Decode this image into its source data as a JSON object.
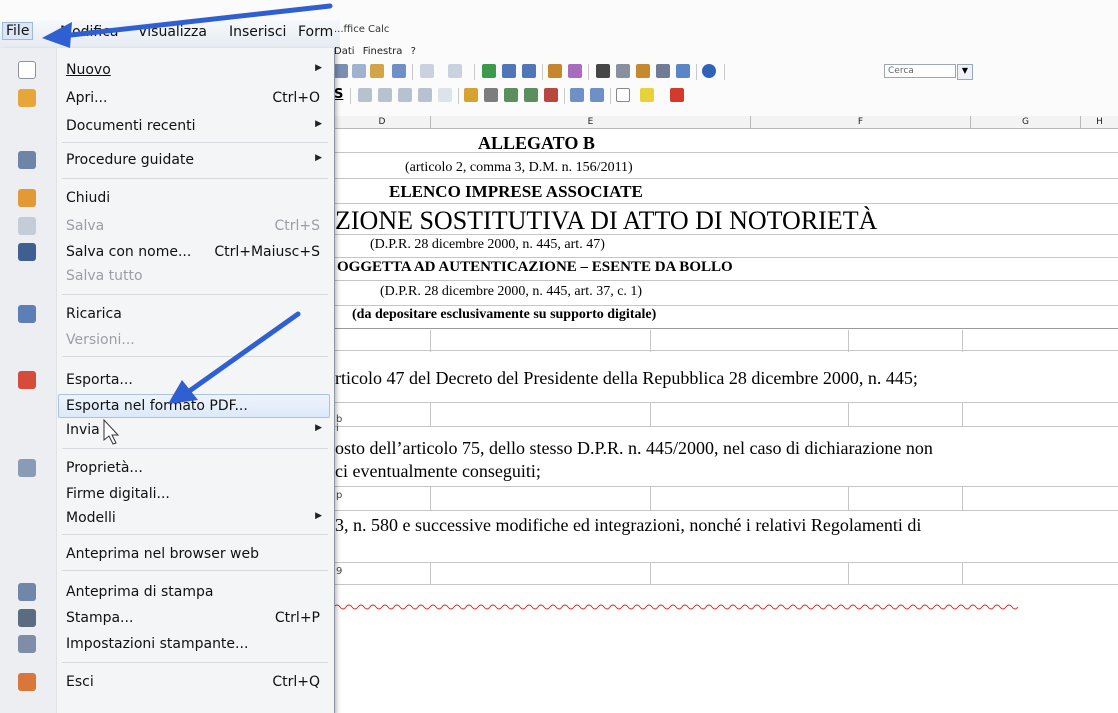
{
  "window": {
    "title": "...ffice Calc"
  },
  "menubar": {
    "items": [
      "File",
      "Modifica",
      "Visualizza",
      "Inserisci",
      "Form"
    ],
    "second_row": [
      "Dati",
      "Finestra",
      "?"
    ]
  },
  "toolbar": {
    "search_placeholder": "Cerca"
  },
  "columns": [
    "D",
    "E",
    "F",
    "G",
    "H"
  ],
  "row_fragments": [
    "b",
    "i",
    "p",
    "9"
  ],
  "sheet": {
    "allegato": "ALLEGATO B",
    "articolo": "(articolo 2, comma 3, D.M. n. 156/2011)",
    "elenco": "ELENCO IMPRESE ASSOCIATE",
    "dichiarazione": "ZIONE SOSTITUTIVA DI ATTO DI NOTORIETÀ",
    "dpr1": "(D.P.R. 28 dicembre 2000, n. 445, art. 47)",
    "soggetta": "OGGETTA AD AUTENTICAZIONE – ESENTE DA BOLLO",
    "dpr2": "(D.P.R. 28 dicembre 2000, n. 445, art. 37, c. 1)",
    "depositare": "(da depositare esclusivamente su supporto digitale)",
    "line1": "rticolo 47 del Decreto del Presidente della Repubblica 28 dicembre 2000, n. 445;",
    "line2": "osto dell’articolo 75, dello stesso D.P.R. n. 445/2000, nel caso di dichiarazione non",
    "line3": "ci eventualmente conseguiti;",
    "line4": "3, n. 580 e successive modifiche ed integrazioni, nonché i relativi Regolamenti di"
  },
  "file_menu": {
    "items": [
      {
        "label": "Nuovo",
        "shortcut": "",
        "submenu": true,
        "icon": "new-document-icon"
      },
      {
        "label": "Apri...",
        "shortcut": "Ctrl+O",
        "submenu": false,
        "icon": "open-folder-icon"
      },
      {
        "label": "Documenti recenti",
        "shortcut": "",
        "submenu": true,
        "icon": ""
      },
      {
        "label": "Procedure guidate",
        "shortcut": "",
        "submenu": true,
        "icon": "wizard-icon"
      },
      {
        "label": "Chiudi",
        "shortcut": "",
        "submenu": false,
        "icon": "close-document-icon"
      },
      {
        "label": "Salva",
        "shortcut": "Ctrl+S",
        "submenu": false,
        "icon": "save-icon",
        "disabled": true
      },
      {
        "label": "Salva con nome...",
        "shortcut": "Ctrl+Maiusc+S",
        "submenu": false,
        "icon": "save-as-icon"
      },
      {
        "label": "Salva tutto",
        "shortcut": "",
        "submenu": false,
        "icon": "",
        "disabled": true
      },
      {
        "label": "Ricarica",
        "shortcut": "",
        "submenu": false,
        "icon": "reload-icon"
      },
      {
        "label": "Versioni...",
        "shortcut": "",
        "submenu": false,
        "icon": "",
        "disabled": true
      },
      {
        "label": "Esporta...",
        "shortcut": "",
        "submenu": false,
        "icon": "export-icon"
      },
      {
        "label": "Esporta nel formato PDF...",
        "shortcut": "",
        "submenu": false,
        "icon": "",
        "highlighted": true
      },
      {
        "label": "Invia",
        "shortcut": "",
        "submenu": true,
        "icon": ""
      },
      {
        "label": "Proprietà...",
        "shortcut": "",
        "submenu": false,
        "icon": "properties-icon"
      },
      {
        "label": "Firme digitali...",
        "shortcut": "",
        "submenu": false,
        "icon": ""
      },
      {
        "label": "Modelli",
        "shortcut": "",
        "submenu": true,
        "icon": ""
      },
      {
        "label": "Anteprima nel browser web",
        "shortcut": "",
        "submenu": false,
        "icon": ""
      },
      {
        "label": "Anteprima di stampa",
        "shortcut": "",
        "submenu": false,
        "icon": "print-preview-icon"
      },
      {
        "label": "Stampa...",
        "shortcut": "Ctrl+P",
        "submenu": false,
        "icon": "print-icon"
      },
      {
        "label": "Impostazioni stampante...",
        "shortcut": "",
        "submenu": false,
        "icon": "printer-settings-icon"
      },
      {
        "label": "Esci",
        "shortcut": "Ctrl+Q",
        "submenu": false,
        "icon": "exit-icon"
      }
    ]
  },
  "colors": {
    "arrow": "#2f5fd0",
    "highlight": "#dde9f8",
    "disabled_text": "#9a9ea6"
  }
}
